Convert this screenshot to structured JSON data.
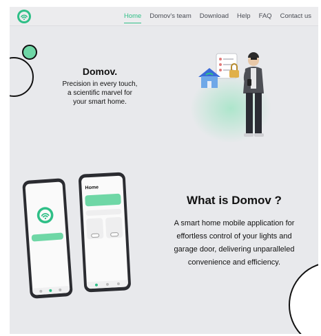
{
  "nav": {
    "items": [
      {
        "label": "Home",
        "active": true
      },
      {
        "label": "Domov's team",
        "active": false
      },
      {
        "label": "Download",
        "active": false
      },
      {
        "label": "Help",
        "active": false
      },
      {
        "label": "FAQ",
        "active": false
      },
      {
        "label": "Contact us",
        "active": false
      }
    ]
  },
  "hero": {
    "title": "Domov.",
    "lines": [
      "Precision in every touch,",
      "a scientific marvel for",
      "your smart home."
    ]
  },
  "about": {
    "title": "What is Domov ?",
    "lines": [
      "A smart home mobile application for",
      "effortless control of your lights and",
      "garage door, delivering unparalleled",
      "convenience and efficiency."
    ]
  },
  "phone_app": {
    "header": "Home"
  },
  "colors": {
    "accent": "#2fbf87",
    "mint": "#6fd7a6",
    "background": "#e8e9ec",
    "dark": "#111111"
  },
  "icons": [
    "domov-logo-icon",
    "house-wifi-icon",
    "padlock-icon",
    "checklist-icon",
    "man-with-phone-illustration"
  ]
}
